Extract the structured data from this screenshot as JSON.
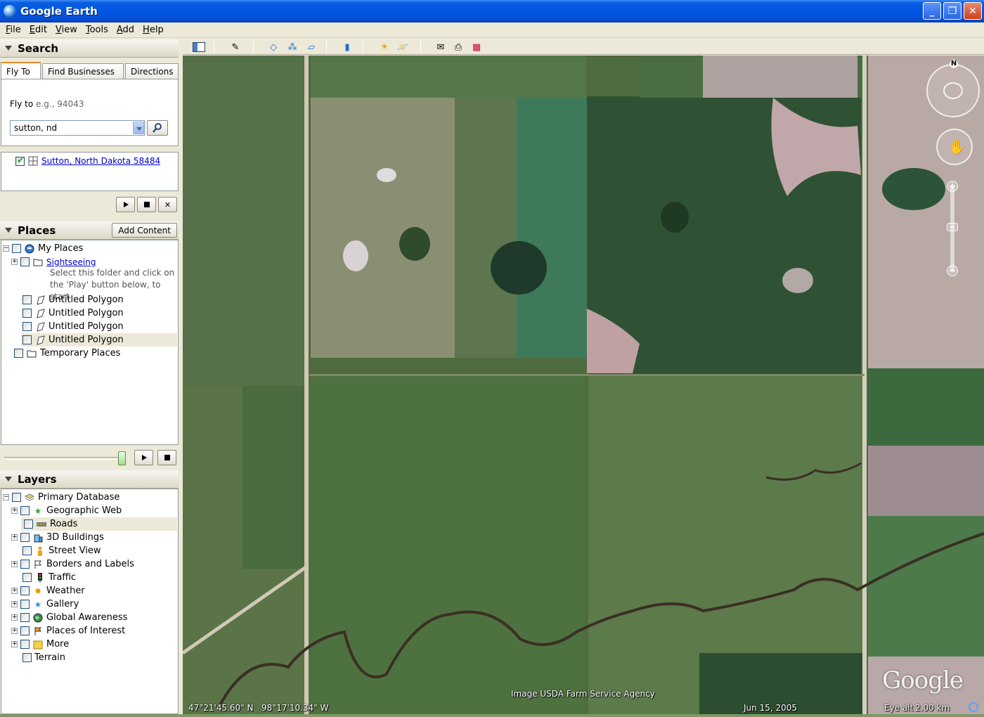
{
  "window": {
    "title": "Google Earth"
  },
  "menu": [
    "File",
    "Edit",
    "View",
    "Tools",
    "Add",
    "Help"
  ],
  "search": {
    "header": "Search",
    "tabs": [
      "Fly To",
      "Find Businesses",
      "Directions"
    ],
    "fly_to_label": "Fly to",
    "fly_to_placeholder": "e.g., 94043",
    "query": "sutton, nd",
    "result": "Sutton, North Dakota 58484"
  },
  "places": {
    "header": "Places",
    "add_content": "Add Content",
    "items": {
      "my_places": "My Places",
      "sightseeing": "Sightseeing",
      "sightseeing_desc_1": "Select this folder and click on",
      "sightseeing_desc_2": "the 'Play' button below, to start",
      "polygon": "Untitled Polygon",
      "temporary": "Temporary Places"
    }
  },
  "layers": {
    "header": "Layers",
    "items": [
      "Primary Database",
      "Geographic Web",
      "Roads",
      "3D Buildings",
      "Street View",
      "Borders and Labels",
      "Traffic",
      "Weather",
      "Gallery",
      "Global Awareness",
      "Places of Interest",
      "More",
      "Terrain"
    ]
  },
  "map": {
    "attribution": "Image USDA Farm Service Agency",
    "lat": "47°21'45.60\" N",
    "lon": "98°17'10.34\" W",
    "date": "Jun 15, 2005",
    "eye_alt_label": "Eye alt",
    "eye_alt_value": "2.00 km",
    "logo": "Google",
    "north": "N"
  },
  "colors": {
    "titlebar": "#0054e3",
    "link": "#0000cc",
    "panel": "#ece9d8"
  }
}
